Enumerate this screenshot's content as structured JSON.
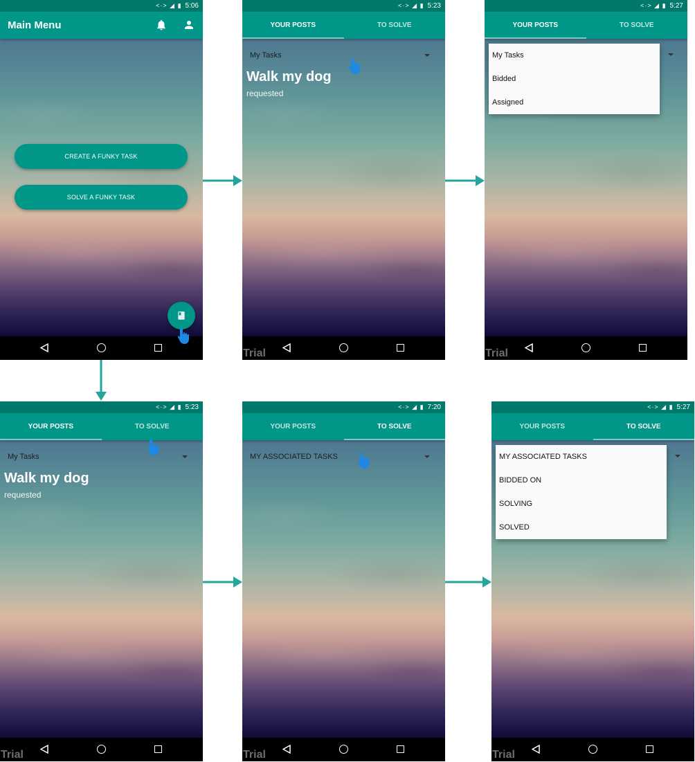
{
  "status_times": [
    "5:06",
    "5:23",
    "5:27",
    "5:23",
    "7:20",
    "5:27"
  ],
  "main_menu": {
    "title": "Main Menu",
    "create_button": "CREATE A FUNKY TASK",
    "solve_button": "SOLVE A FUNKY TASK"
  },
  "tabs": {
    "your_posts": "YOUR POSTS",
    "to_solve": "TO SOLVE"
  },
  "your_posts": {
    "spinner_value": "My Tasks",
    "task_title": "Walk my dog",
    "task_status": "requested",
    "options": [
      "My Tasks",
      "Bidded",
      "Assigned"
    ]
  },
  "to_solve": {
    "spinner_value": "MY ASSOCIATED TASKS",
    "options": [
      "MY ASSOCIATED TASKS",
      "BIDDED ON",
      "SOLVING",
      "SOLVED"
    ]
  },
  "watermark": "Trial",
  "colors": {
    "primary": "#009688",
    "primary_dark": "#00796b",
    "arrow": "#26a69a",
    "pointer": "#1e88e5"
  }
}
